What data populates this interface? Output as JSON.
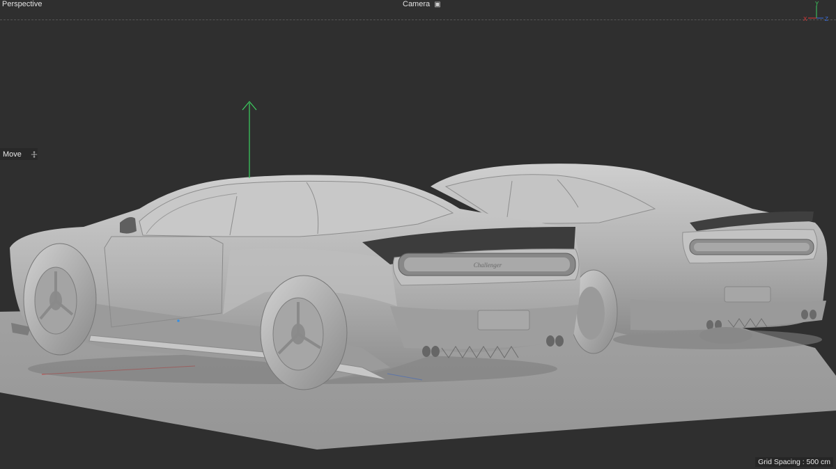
{
  "viewport": {
    "view_name": "Perspective",
    "camera_label": "Camera",
    "active_tool": "Move",
    "grid_spacing": "Grid Spacing : 500 cm",
    "axes": {
      "x": "X",
      "y": "Y",
      "z": "Z"
    }
  },
  "scene": {
    "objects": [
      "car-model-front",
      "car-model-rear"
    ],
    "badge_text": "Challenger"
  },
  "colors": {
    "background": "#2f2f2f",
    "floor": "#9a9a9a",
    "car_body": "#b4b4b4",
    "axis_x": "#e03838",
    "axis_y": "#3cd060",
    "axis_z": "#3a6fe0"
  },
  "icons": {
    "move": "move-crosshair-icon",
    "camera": "camera-icon"
  }
}
